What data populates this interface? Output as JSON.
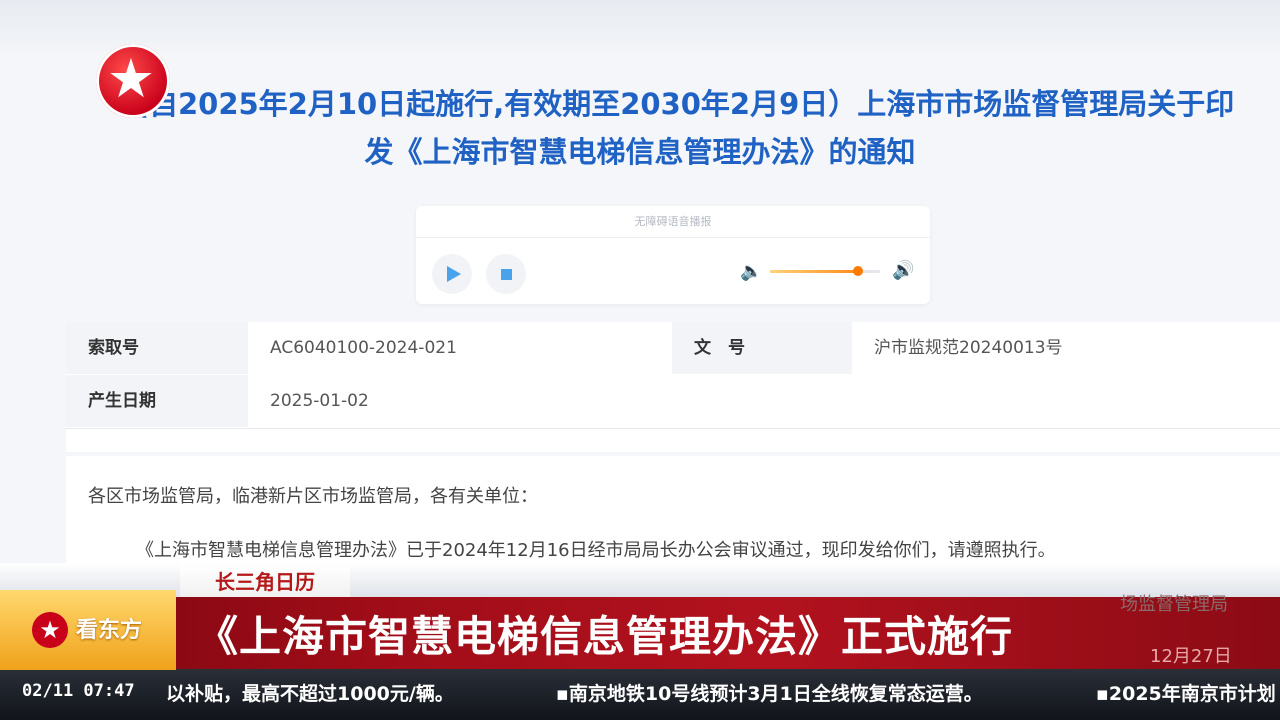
{
  "document": {
    "title_line1": "(自2025年2月10日起施行,有效期至2030年2月9日）上海市市场监督管理局关于印",
    "title_line2": "发《上海市智慧电梯信息管理办法》的通知"
  },
  "audio_player": {
    "caption": "无障碍语音播报",
    "volume_fraction": 0.8
  },
  "metadata": {
    "index_label": "索取号",
    "index_value": "AC6040100-2024-021",
    "doc_no_label": "文　号",
    "doc_no_value": "沪市监规范20240013号",
    "date_label": "产生日期",
    "date_value": "2025-01-02"
  },
  "body": {
    "salutation": "各区市场监管局，临港新片区市场监管局，各有关单位：",
    "paragraph1": "《上海市智慧电梯信息管理办法》已于2024年12月16日经市局局长办公会审议通过，现印发给你们，请遵照执行。",
    "signature_partial": "场监督管理局",
    "date_partial": "12月27日"
  },
  "broadcast": {
    "section_tag": "长三角日历",
    "brand": "看东方",
    "headline": "《上海市智慧电梯信息管理办法》正式施行",
    "ticker_time": "02/11 07:47",
    "ticker_items": [
      "以补贴，最高不超过1000元/辆。",
      "▪南京地铁10号线预计3月1日全线恢复常态运营。",
      "▪2025年南京市计划"
    ]
  },
  "colors": {
    "title_blue": "#1f62c3",
    "headline_red": "#b2121e",
    "accent_orange": "#ff7a00"
  }
}
